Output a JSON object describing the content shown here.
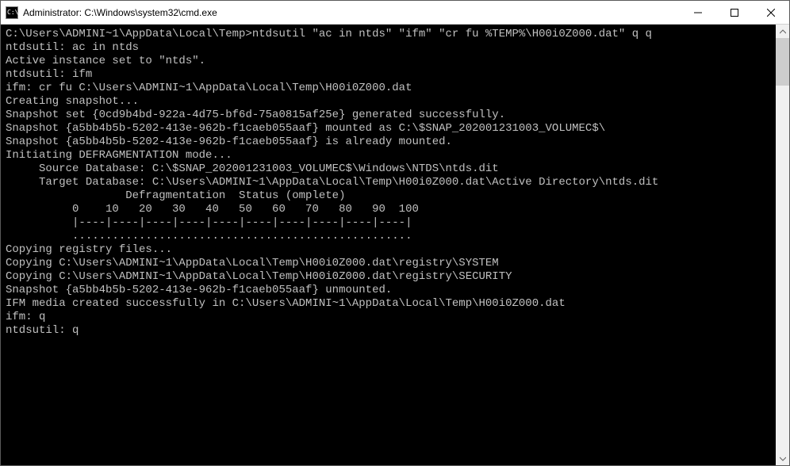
{
  "window": {
    "title": "Administrator: C:\\Windows\\system32\\cmd.exe",
    "icon_glyph": "C:\\"
  },
  "terminal": {
    "lines": [
      "C:\\Users\\ADMINI~1\\AppData\\Local\\Temp>ntdsutil \"ac in ntds\" \"ifm\" \"cr fu %TEMP%\\H00i0Z000.dat\" q q",
      "ntdsutil: ac in ntds",
      "Active instance set to \"ntds\".",
      "ntdsutil: ifm",
      "ifm: cr fu C:\\Users\\ADMINI~1\\AppData\\Local\\Temp\\H00i0Z000.dat",
      "Creating snapshot...",
      "Snapshot set {0cd9b4bd-922a-4d75-bf6d-75a0815af25e} generated successfully.",
      "Snapshot {a5bb4b5b-5202-413e-962b-f1caeb055aaf} mounted as C:\\$SNAP_202001231003_VOLUMEC$\\",
      "Snapshot {a5bb4b5b-5202-413e-962b-f1caeb055aaf} is already mounted.",
      "Initiating DEFRAGMENTATION mode...",
      "     Source Database: C:\\$SNAP_202001231003_VOLUMEC$\\Windows\\NTDS\\ntds.dit",
      "     Target Database: C:\\Users\\ADMINI~1\\AppData\\Local\\Temp\\H00i0Z000.dat\\Active Directory\\ntds.dit",
      "",
      "                  Defragmentation  Status (omplete)",
      "",
      "          0    10   20   30   40   50   60   70   80   90  100",
      "          |----|----|----|----|----|----|----|----|----|----|",
      "          ...................................................",
      "",
      "Copying registry files...",
      "Copying C:\\Users\\ADMINI~1\\AppData\\Local\\Temp\\H00i0Z000.dat\\registry\\SYSTEM",
      "Copying C:\\Users\\ADMINI~1\\AppData\\Local\\Temp\\H00i0Z000.dat\\registry\\SECURITY",
      "Snapshot {a5bb4b5b-5202-413e-962b-f1caeb055aaf} unmounted.",
      "IFM media created successfully in C:\\Users\\ADMINI~1\\AppData\\Local\\Temp\\H00i0Z000.dat",
      "ifm: q",
      "ntdsutil: q"
    ]
  }
}
